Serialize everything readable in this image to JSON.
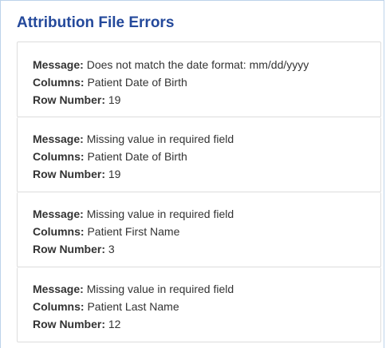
{
  "panel": {
    "title": "Attribution File Errors"
  },
  "labels": {
    "message": "Message:",
    "columns": "Columns:",
    "row_number": "Row Number:"
  },
  "errors": [
    {
      "message": "Does not match the date format: mm/dd/yyyy",
      "columns": "Patient Date of Birth",
      "row_number": "19"
    },
    {
      "message": "Missing value in required field",
      "columns": "Patient Date of Birth",
      "row_number": "19"
    },
    {
      "message": "Missing value in required field",
      "columns": "Patient First Name",
      "row_number": "3"
    },
    {
      "message": "Missing value in required field",
      "columns": "Patient Last Name",
      "row_number": "12"
    }
  ],
  "colors": {
    "title": "#24499b",
    "panel_border": "#bcd3ea",
    "card_border": "#dddddd",
    "text": "#333333"
  }
}
